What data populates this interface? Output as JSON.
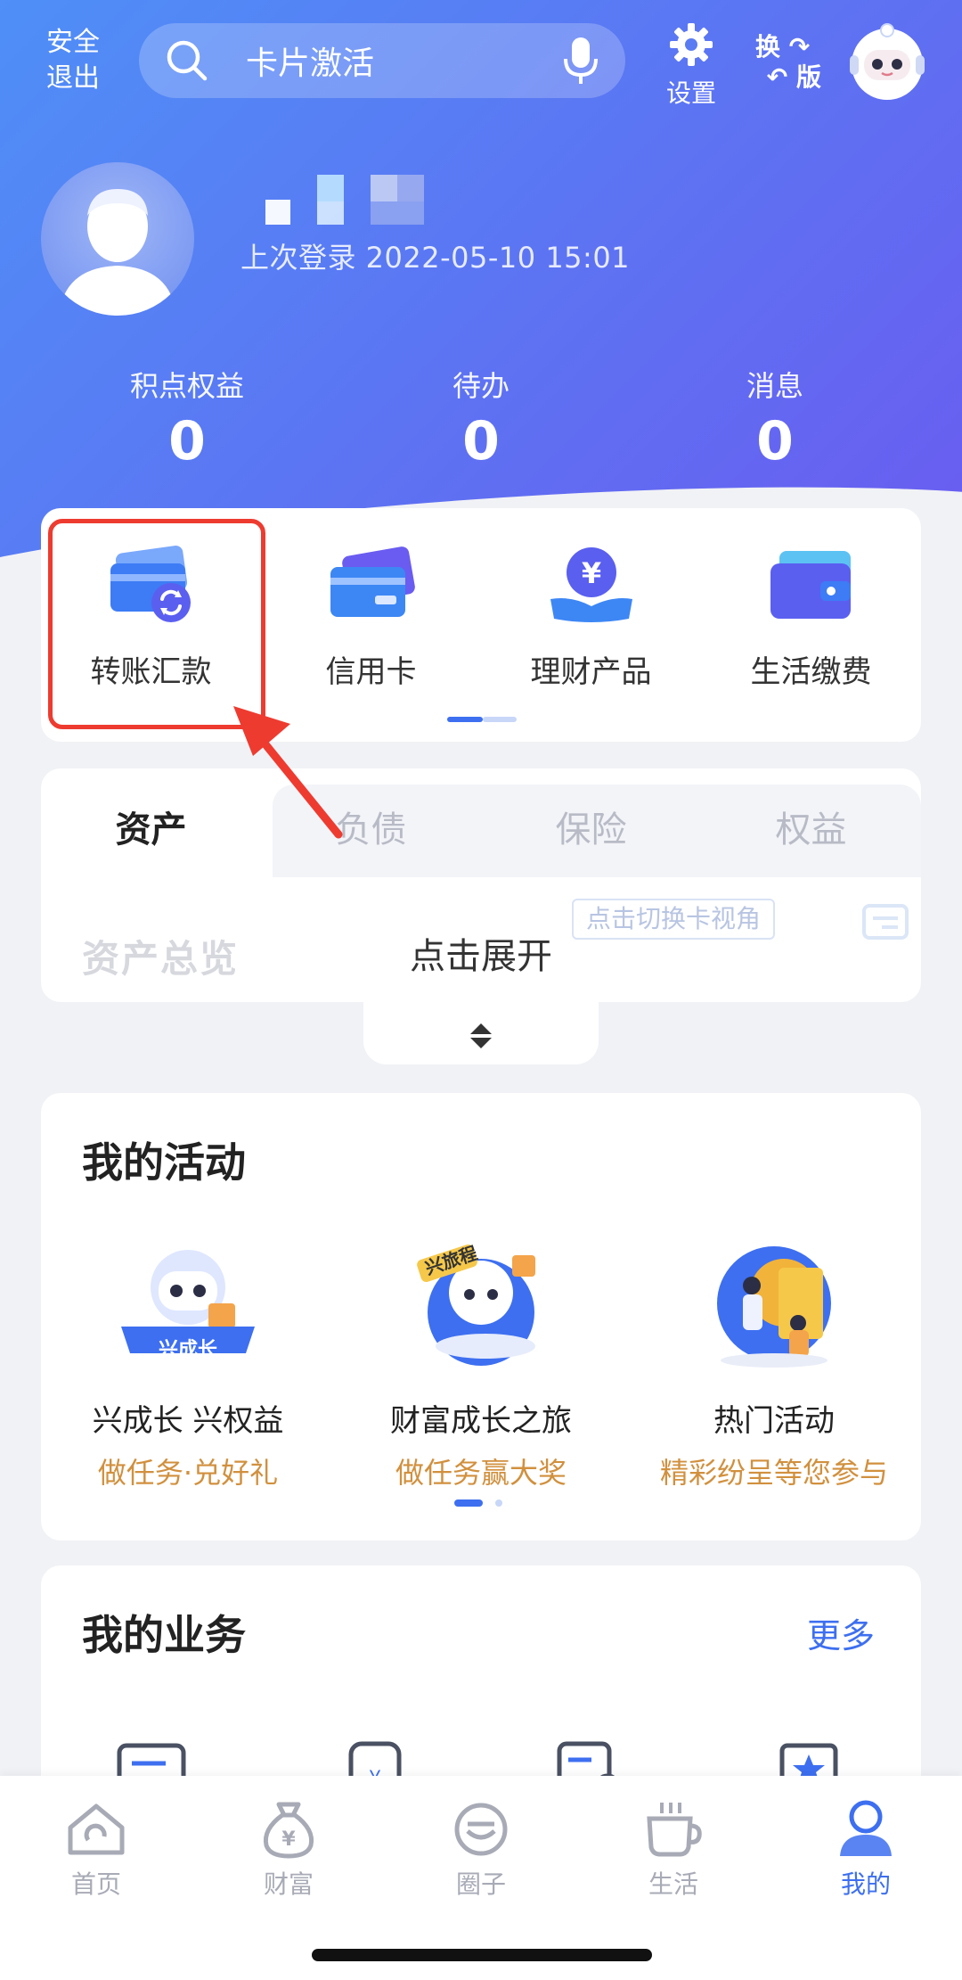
{
  "topbar": {
    "logout_line1": "安全",
    "logout_line2": "退出",
    "search_placeholder": "卡片激活",
    "settings_label": "设置",
    "switch_version_line1": "换",
    "switch_version_line2": "版"
  },
  "profile": {
    "last_login": "上次登录 2022-05-10 15:01"
  },
  "stats": [
    {
      "label": "积点权益",
      "value": "0"
    },
    {
      "label": "待办",
      "value": "0"
    },
    {
      "label": "消息",
      "value": "0"
    }
  ],
  "quick_actions": [
    {
      "label": "转账汇款",
      "icon": "transfer-icon"
    },
    {
      "label": "信用卡",
      "icon": "credit-card-icon"
    },
    {
      "label": "理财产品",
      "icon": "yuan-coin-icon"
    },
    {
      "label": "生活缴费",
      "icon": "wallet-icon"
    }
  ],
  "asset_tabs": [
    "资产",
    "负债",
    "保险",
    "权益"
  ],
  "assets": {
    "overview_label": "资产总览",
    "expand_label": "点击展开",
    "card_view_label": "点击切换卡视角"
  },
  "activities": {
    "title": "我的活动",
    "badge_growth": "兴成长",
    "badge_journey": "兴旅程",
    "items": [
      {
        "title": "兴成长 兴权益",
        "subtitle": "做任务·兑好礼"
      },
      {
        "title": "财富成长之旅",
        "subtitle": "做任务赢大奖"
      },
      {
        "title": "热门活动",
        "subtitle": "精彩纷呈等您参与"
      }
    ]
  },
  "business": {
    "title": "我的业务",
    "more_label": "更多"
  },
  "bottom_nav": [
    {
      "label": "首页",
      "icon": "home-icon"
    },
    {
      "label": "财富",
      "icon": "money-bag-icon"
    },
    {
      "label": "圈子",
      "icon": "circle-face-icon"
    },
    {
      "label": "生活",
      "icon": "coffee-cup-icon"
    },
    {
      "label": "我的",
      "icon": "user-icon",
      "active": true
    }
  ],
  "colors": {
    "accent": "#3d6ff0",
    "highlight": "#ee3b30",
    "gold_text": "#d1903e"
  }
}
